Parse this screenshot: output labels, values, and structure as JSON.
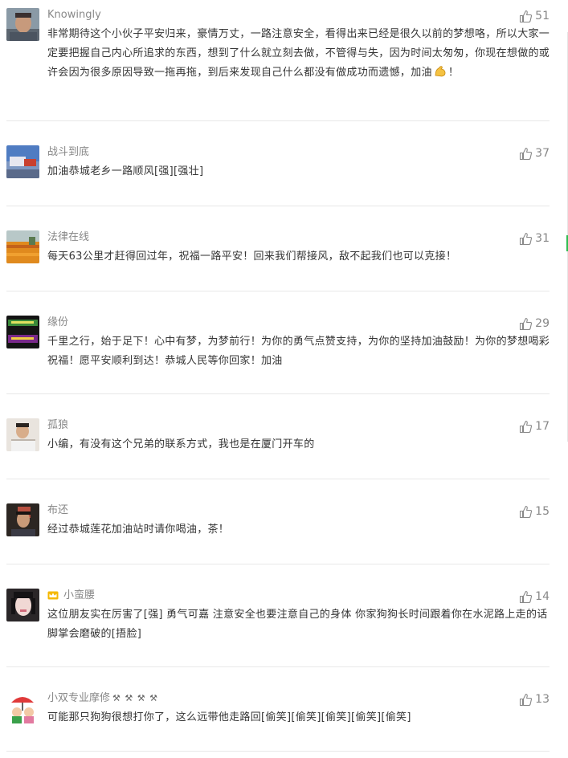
{
  "comments": [
    {
      "nickname": "Knowingly",
      "likes": "51",
      "text_before": "非常期待这个小伙子平安归来，豪情万丈，一路注意安全，看得出来已经是很久以前的梦想咯，所以大家一定要把握自己内心所追求的东西，想到了什么就立刻去做，不管得与失，因为时间太匆匆，你现在想做的或许会因为很多原因导致一拖再拖，到后来发现自己什么都没有做成功而遗憾，加油",
      "emoji": "flexed-biceps-emoji",
      "text_after": "！"
    },
    {
      "nickname": "战斗到底",
      "likes": "37",
      "text": "加油恭城老乡一路顺风[强][强壮]"
    },
    {
      "nickname": "法律在线",
      "likes": "31",
      "text": "每天63公里才赶得回过年，祝福一路平安！回来我们帮接风，敌不起我们也可以克接！"
    },
    {
      "nickname": "缘份",
      "likes": "29",
      "text": "千里之行，始于足下！心中有梦，为梦前行！为你的勇气点赞支持，为你的坚持加油鼓励！为你的梦想喝彩祝福！愿平安顺利到达！恭城人民等你回家！加油"
    },
    {
      "nickname": "孤狼",
      "likes": "17",
      "text": "小编，有没有这个兄弟的联系方式，我也是在厦门开车的"
    },
    {
      "nickname": "布还",
      "likes": "15",
      "text": "经过恭城莲花加油站时请你喝油，茶！"
    },
    {
      "nickname": "小蛮腰",
      "likes": "14",
      "badge": "crown-icon",
      "text": "这位朋友实在厉害了[强] 勇气可嘉 注意安全也要注意自己的身体 你家狗狗长时间跟着你在水泥路上走的话脚掌会磨破的[捂脸]"
    },
    {
      "nickname": "小双专业摩修",
      "nickname_suffix": "⚒ ⚒ ⚒ ⚒",
      "likes": "13",
      "text": "可能那只狗狗很想打你了，这么远带他走路回[偷笑][偷笑][偷笑][偷笑][偷笑]"
    }
  ],
  "colors": {
    "nickname": "#888888",
    "text": "#353535",
    "divider": "#e8e8e8",
    "scroll_indicator": "#2dbd51"
  },
  "icons": {
    "like": "thumbs-up-icon"
  }
}
